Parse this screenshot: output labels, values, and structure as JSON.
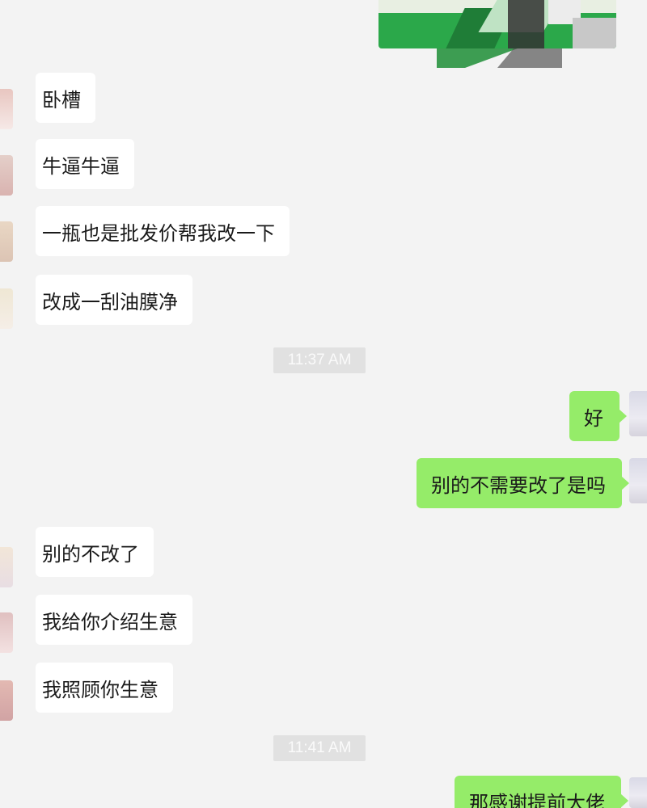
{
  "colors": {
    "background": "#f3f3f3",
    "received_bubble": "#ffffff",
    "sent_bubble": "#95ec69"
  },
  "messages": {
    "m1": "卧槽",
    "m2": "牛逼牛逼",
    "m3": "一瓶也是批发价帮我改一下",
    "m4": "改成一刮油膜净",
    "t1": "11:37 AM",
    "m5": "好",
    "m6": "别的不需要改了是吗",
    "m7": "别的不改了",
    "m8": "我给你介绍生意",
    "m9": "我照顾你生意",
    "t2": "11:41 AM",
    "m10": "那感谢提前大佬"
  }
}
